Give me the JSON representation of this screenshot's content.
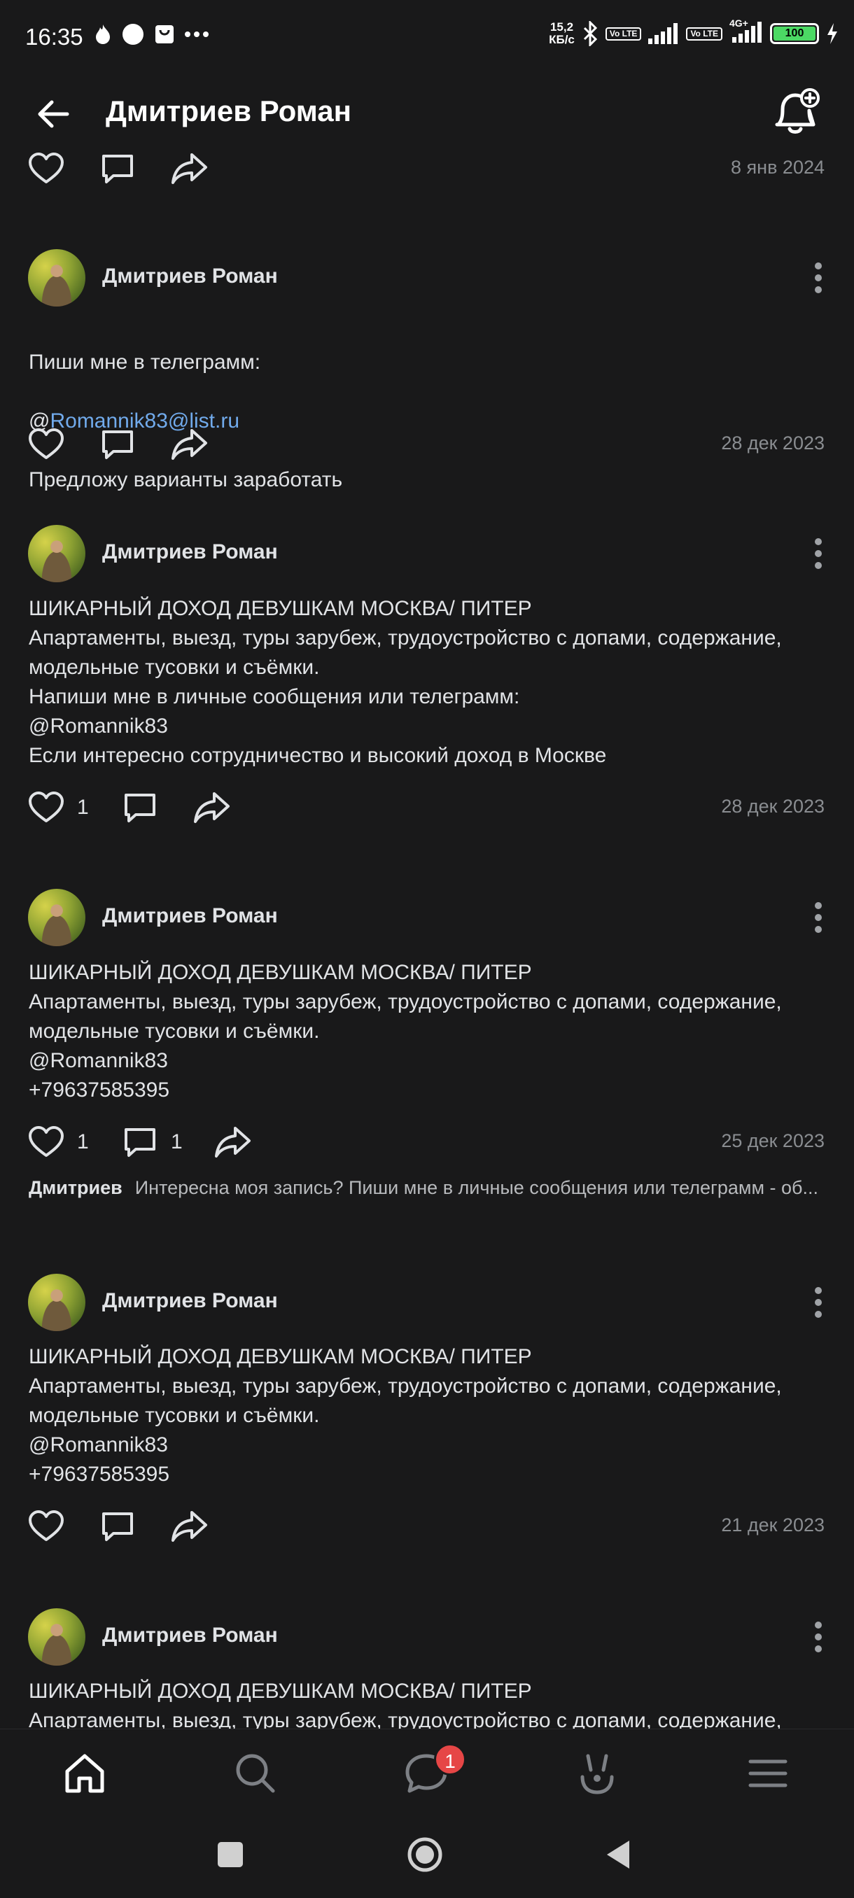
{
  "status": {
    "time": "16:35",
    "speed_value": "15,2",
    "speed_unit": "КБ/с",
    "volte1": "Vo LTE",
    "volte2": "Vo LTE",
    "network": "4G+",
    "battery": "100"
  },
  "header": {
    "title": "Дмитриев Роман"
  },
  "posts": [
    {
      "date": "8 янв 2024"
    },
    {
      "author": "Дмитриев Роман",
      "line1": "Пиши мне в телеграмм:",
      "at": "@",
      "link": "Romannik83@list.ru",
      "line3": "Предложу варианты заработать",
      "date": "28 дек 2023"
    },
    {
      "author": "Дмитриев Роман",
      "text": "ШИКАРНЫЙ ДОХОД ДЕВУШКАМ МОСКВА/ ПИТЕР\nАпартаменты, выезд, туры зарубеж, трудоустройство с допами, содержание, модельные тусовки и съёмки.\nНапиши мне в личные сообщения или телеграмм:\n@Romannik83\nЕсли интересно сотрудничество и высокий доход в Москве",
      "likes": "1",
      "date": "28 дек 2023"
    },
    {
      "author": "Дмитриев Роман",
      "text": "ШИКАРНЫЙ ДОХОД ДЕВУШКАМ МОСКВА/ ПИТЕР\nАпартаменты, выезд, туры зарубеж, трудоустройство с допами, содержание, модельные тусовки и съёмки.\n@Romannik83\n+79637585395",
      "likes": "1",
      "comments": "1",
      "date": "25 дек 2023",
      "comment_author": "Дмитриев",
      "comment_text": "Интересна моя запись? Пиши мне в личные сообщения или телеграмм - об..."
    },
    {
      "author": "Дмитриев Роман",
      "text": "ШИКАРНЫЙ ДОХОД ДЕВУШКАМ МОСКВА/ ПИТЕР\nАпартаменты, выезд, туры зарубеж, трудоустройство с допами, содержание, модельные тусовки и съёмки.\n@Romannik83\n+79637585395",
      "date": "21 дек 2023"
    },
    {
      "author": "Дмитриев Роман",
      "text": "ШИКАРНЫЙ ДОХОД ДЕВУШКАМ МОСКВА/ ПИТЕР\nАпартаменты, выезд, туры зарубеж, трудоустройство с допами, содержание,"
    }
  ],
  "tabbar": {
    "messages_badge": "1"
  },
  "icons": {
    "back": "arrow-left-icon",
    "bell": "bell-plus-icon",
    "like": "heart-icon",
    "comment": "comment-icon",
    "share": "share-icon",
    "home": "home-icon",
    "search": "search-icon",
    "messages": "messages-icon",
    "clips": "clips-icon",
    "menu": "menu-icon"
  },
  "colors": {
    "background": "#19191a",
    "text": "#e1e3e6",
    "secondary": "#8a8d91",
    "link": "#71aaeb",
    "badge": "#e64646",
    "battery": "#4cd964"
  }
}
